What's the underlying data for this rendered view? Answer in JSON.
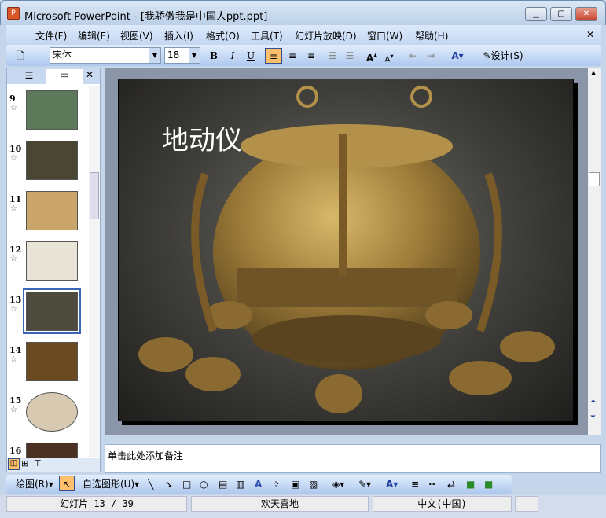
{
  "window": {
    "title": "Microsoft PowerPoint - [我骄傲我是中国人ppt.ppt]",
    "app_icon": "P"
  },
  "menu": [
    "文件(F)",
    "编辑(E)",
    "视图(V)",
    "插入(I)",
    "格式(O)",
    "工具(T)",
    "幻灯片放映(D)",
    "窗口(W)",
    "帮助(H)"
  ],
  "toolbar": {
    "font": "宋体",
    "size": "18",
    "bold": "B",
    "italic": "I",
    "underline": "U",
    "design": "设计(S)"
  },
  "thumbnails": [
    {
      "num": "9",
      "bg": "#5c7a5a"
    },
    {
      "num": "10",
      "bg": "#4a4636"
    },
    {
      "num": "11",
      "bg": "#c9a56a"
    },
    {
      "num": "12",
      "bg": "#e8e4d8"
    },
    {
      "num": "13",
      "bg": "#4d4a3e"
    },
    {
      "num": "14",
      "bg": "#6b4a22"
    },
    {
      "num": "15",
      "bg": "#d8cab0"
    },
    {
      "num": "16",
      "bg": "#4a3222"
    }
  ],
  "slide": {
    "title": "地动仪"
  },
  "notes": {
    "placeholder": "单击此处添加备注"
  },
  "drawbar": {
    "draw": "绘图(R)",
    "autoshapes": "自选图形(U)"
  },
  "status": {
    "slide": "幻灯片 13 / 39",
    "design": "欢天喜地",
    "language": "中文(中国)"
  }
}
